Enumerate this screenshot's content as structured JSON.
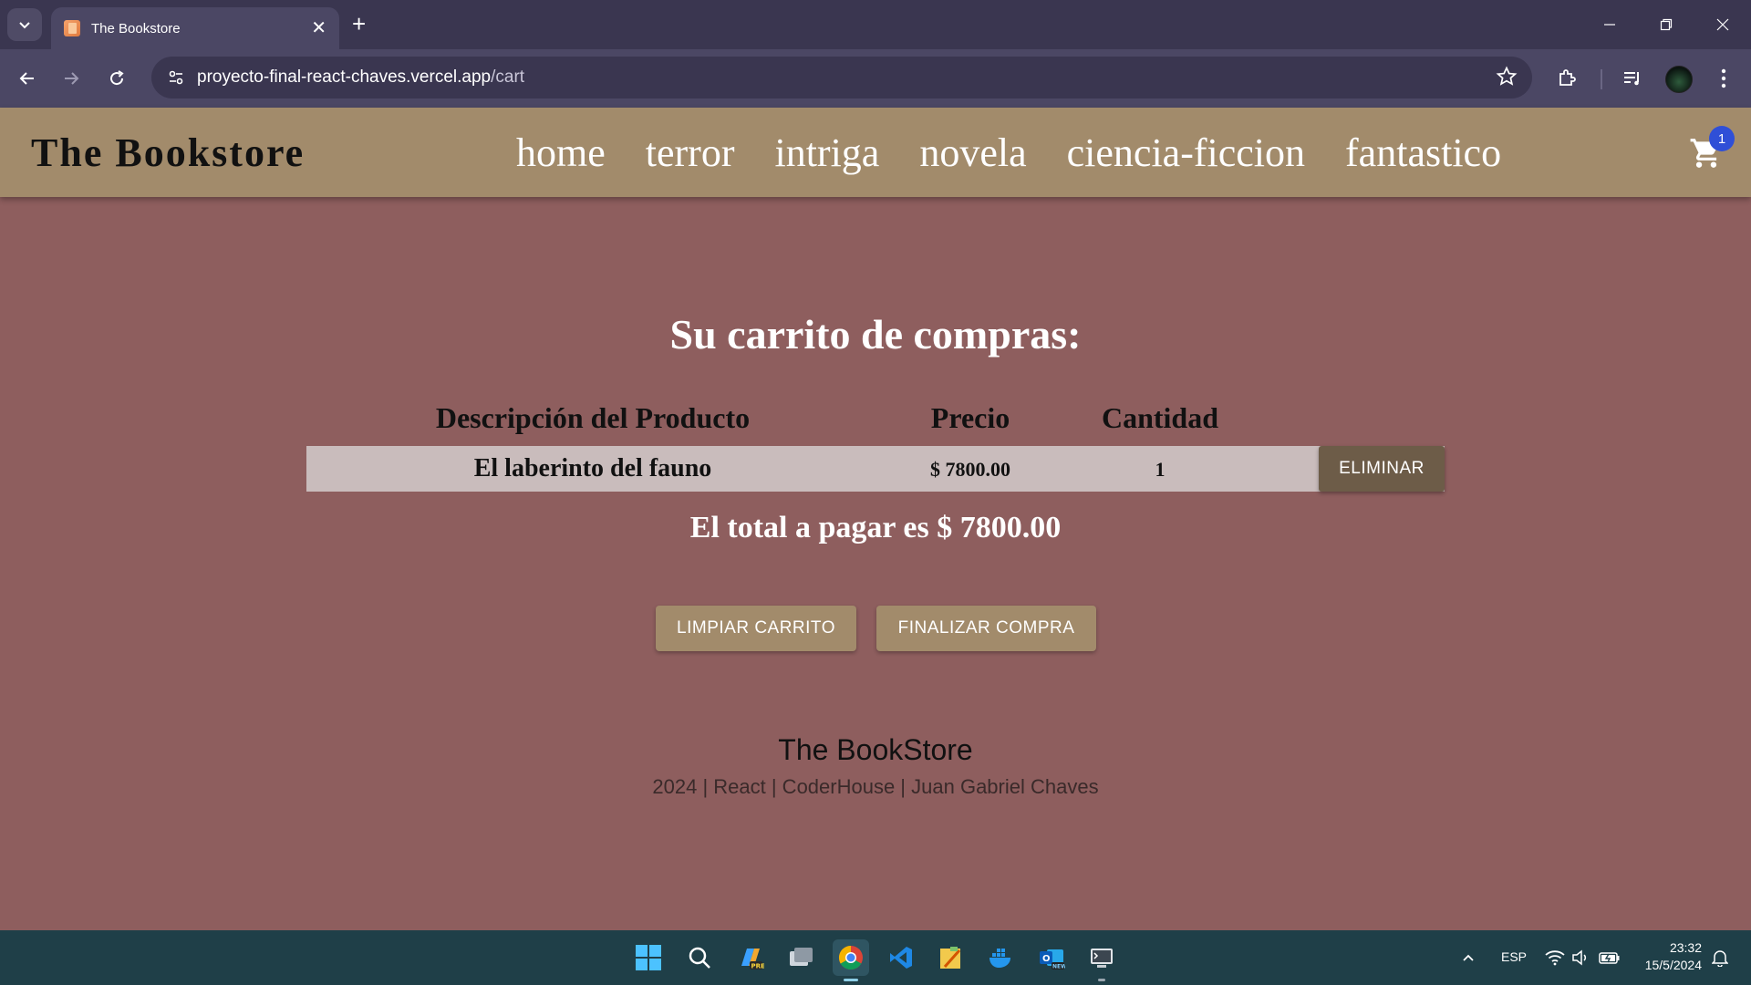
{
  "browser": {
    "tab_title": "The Bookstore",
    "url_host": "proyecto-final-react-chaves.vercel.app",
    "url_path": "/cart"
  },
  "site": {
    "brand": "The Bookstore",
    "nav": [
      "home",
      "terror",
      "intriga",
      "novela",
      "ciencia-ficcion",
      "fantastico"
    ],
    "cart_count": "1",
    "accent_color": "#a28b6b",
    "background_color": "#8e5e5e"
  },
  "cart": {
    "title": "Su carrito de compras:",
    "columns": {
      "description": "Descripción del Producto",
      "price": "Precio",
      "quantity": "Cantidad"
    },
    "items": [
      {
        "name": "El laberinto del fauno",
        "price": "$ 7800.00",
        "quantity": "1",
        "remove_label": "ELIMINAR"
      }
    ],
    "total_text": "El total a pagar es $ 7800.00",
    "clear_label": "LIMPIAR CARRITO",
    "checkout_label": "FINALIZAR COMPRA"
  },
  "footer": {
    "title": "The BookStore",
    "subtitle": "2024 | React | CoderHouse | Juan Gabriel Chaves"
  },
  "taskbar": {
    "language": "ESP",
    "time": "23:32",
    "date": "15/5/2024",
    "apps": [
      "start-icon",
      "search-icon",
      "copilot-icon",
      "task-view-icon",
      "chrome-icon",
      "vscode-icon",
      "sticky-notes-icon",
      "docker-icon",
      "outlook-icon",
      "terminal-icon"
    ]
  }
}
